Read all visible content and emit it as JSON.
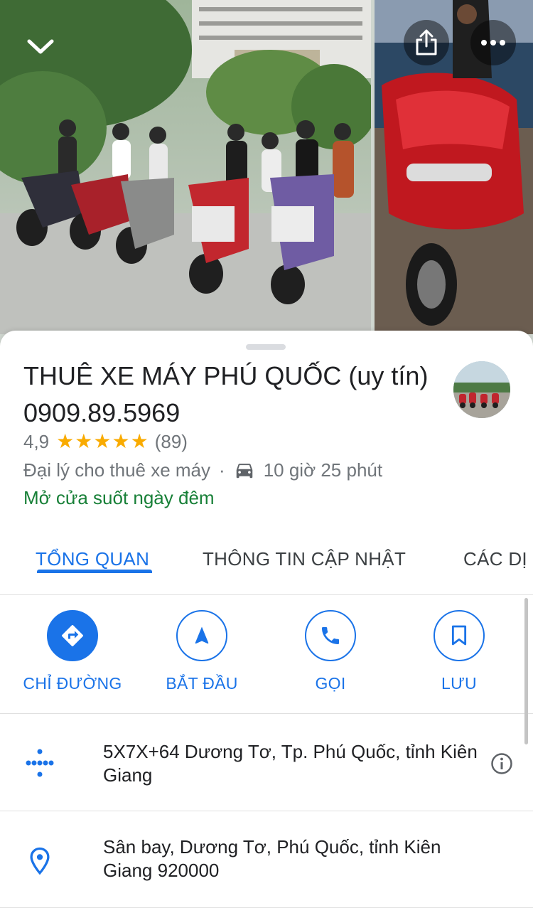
{
  "place": {
    "title": "THUÊ XE MÁY PHÚ QUỐC (uy tín) 0909.89.5969",
    "rating": "4,9",
    "stars": 5,
    "review_count": "(89)",
    "category": "Đại lý cho thuê xe máy",
    "separator": "·",
    "drive_time": "10 giờ 25 phút",
    "hours_status": "Mở cửa suốt ngày đêm"
  },
  "tabs": [
    {
      "label": "TỔNG QUAN",
      "active": true
    },
    {
      "label": "THÔNG TIN CẬP NHẬT",
      "active": false
    },
    {
      "label": "CÁC DỊ",
      "active": false
    }
  ],
  "actions": [
    {
      "label": "CHỈ ĐƯỜNG",
      "icon": "directions-icon"
    },
    {
      "label": "BẮT ĐẦU",
      "icon": "navigation-arrow-icon"
    },
    {
      "label": "GỌI",
      "icon": "phone-icon"
    },
    {
      "label": "LƯU",
      "icon": "bookmark-icon"
    }
  ],
  "info": {
    "plus_code": "5X7X+64 Dương Tơ, Tp. Phú Quốc, tỉnh Kiên Giang",
    "address": "Sân bay, Dương Tơ, Phú Quốc, tỉnh Kiên Giang 920000"
  },
  "colors": {
    "accent": "#1a73e8",
    "open_green": "#188038",
    "star": "#f9ab00",
    "secondary_text": "#70757a"
  }
}
